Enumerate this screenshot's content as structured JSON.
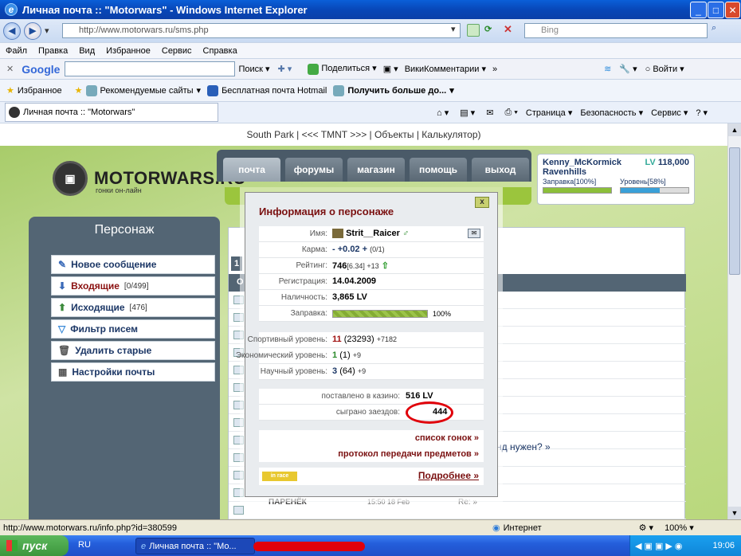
{
  "window": {
    "title": "Личная почта :: \"Motorwars\" - Windows Internet Explorer"
  },
  "address": {
    "url": "http://www.motorwars.ru/sms.php",
    "search_placeholder": "Bing"
  },
  "menu": [
    "Файл",
    "Правка",
    "Вид",
    "Избранное",
    "Сервис",
    "Справка"
  ],
  "google_bar": {
    "logo": "Google",
    "search": "Поиск",
    "share": "Поделиться",
    "wiki": "ВикиКомментарии",
    "login": "Войти"
  },
  "favorites_bar": {
    "favorites": "Избранное",
    "recommended": "Рекомендуемые сайты",
    "hotmail": "Бесплатная почта Hotmail",
    "more": "Получить больше до..."
  },
  "tab": {
    "title": "Личная почта :: \"Motorwars\"",
    "page": "Страница",
    "security": "Безопасность",
    "service": "Сервис"
  },
  "site": {
    "top_links": "South Park | <<< TMNT >>> | Объекты | Калькулятор)",
    "logo": "MOTORWARS.RU",
    "logo_sub": "гонки он-лайн",
    "nav": [
      "почта",
      "форумы",
      "магазин",
      "помощь",
      "выход"
    ],
    "user": {
      "name": "Kenny_McKormick",
      "team": "Ravenhills",
      "lv_label": "LV",
      "lv_value": "118,000",
      "fuel": "Заправка[100%]",
      "level": "Уровень[58%]",
      "fuel_fill": 1.0,
      "level_fill": 0.58
    }
  },
  "left_panel": {
    "title": "Персонаж",
    "items": [
      {
        "label": "Новое сообщение",
        "count": ""
      },
      {
        "label": "Входящие",
        "count": "[0/499]"
      },
      {
        "label": "Исходящие",
        "count": "[476]"
      },
      {
        "label": "Фильтр писем",
        "count": ""
      },
      {
        "label": "Удалить старые",
        "count": ""
      },
      {
        "label": "Настройки почты",
        "count": ""
      }
    ]
  },
  "mail_snippets": {
    "page_num": "1",
    "header_frag": "У в",
    "o_frag": "О",
    "row_text": "нд нужен? »",
    "last_sender": "ПАРЕНЁК",
    "last_time": "15:50 18 Feb",
    "last_subj": "Re: »"
  },
  "popup": {
    "title": "Информация о персонаже",
    "close": "x",
    "rows": [
      {
        "label": "Имя:",
        "value": "Strit__Raicer",
        "extra": ""
      },
      {
        "label": "Карма:",
        "value": "- +0.02 +",
        "extra": "(0/1)"
      },
      {
        "label": "Рейтинг:",
        "value": "746",
        "extra": "[6.34] +13"
      },
      {
        "label": "Регистрация:",
        "value": "14.04.2009",
        "extra": ""
      },
      {
        "label": "Наличность:",
        "value": "3,865 LV",
        "extra": ""
      },
      {
        "label": "Заправка:",
        "value": "",
        "extra": "100%"
      }
    ],
    "fuel_fill": 1.0,
    "levels": [
      {
        "label": "Спортивный уровень:",
        "value": "11",
        "extra": "(23293)",
        "bonus": "+7182"
      },
      {
        "label": "Экономический уровень:",
        "value": "1",
        "extra": "(1)",
        "bonus": "+9"
      },
      {
        "label": "Научный уровень:",
        "value": "3",
        "extra": "(64)",
        "bonus": "+9"
      }
    ],
    "casino": {
      "label": "поставлено в казино:",
      "value": "516 LV"
    },
    "races": {
      "label": "сыграно заездов:",
      "value": "444"
    },
    "links": [
      "список гонок »",
      "протокол передачи предметов »"
    ],
    "badge": "in race",
    "more": "Подробнее »"
  },
  "status": {
    "url": "http://www.motorwars.ru/info.php?id=380599",
    "zone": "Интернет",
    "zoom": "100%"
  },
  "taskbar": {
    "start": "пуск",
    "lang": "RU",
    "window": "Личная почта :: \"Mo...",
    "clock": "19:06"
  }
}
